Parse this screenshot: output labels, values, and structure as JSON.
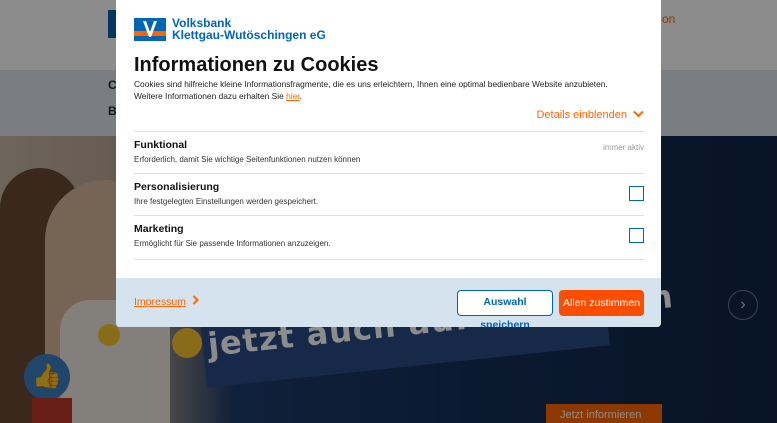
{
  "background": {
    "header_right_text": "on",
    "nav_items": [
      "C",
      "B"
    ],
    "banner_text": "jetzt auch auf Instagram",
    "cta_label": "Jetzt informieren",
    "next_arrow": "›"
  },
  "modal": {
    "logo": {
      "line1": "Volksbank",
      "line2": "Klettgau-Wutöschingen eG"
    },
    "title": "Informationen zu Cookies",
    "intro_text": "Cookies sind hilfreiche kleine Informationsfragmente, die es uns erleichtern, Ihnen eine optimal bedienbare Website anzubieten. Weitere Informationen dazu erhalten Sie ",
    "intro_link": "hier",
    "intro_end": ".",
    "details_label": "Details einblenden",
    "sections": [
      {
        "title": "Funktional",
        "description": "Erforderlich, damit Sie wichtige Seitenfunktionen nutzen können",
        "status": "immer aktiv"
      },
      {
        "title": "Personalisierung",
        "description": "Ihre festgelegten Einstellungen werden gespeichert.",
        "checked": false
      },
      {
        "title": "Marketing",
        "description": "Ermöglicht für Sie passende Informationen anzuzeigen.",
        "checked": false
      }
    ],
    "footer": {
      "impressum_label": "Impressum",
      "save_label": "Auswahl speichern",
      "accept_all_label": "Allen zustimmen"
    }
  },
  "colors": {
    "brand_blue": "#0066b3",
    "brand_orange": "#ff6600",
    "accept_button": "#ff4d00",
    "footer_bg": "#d5e3ef"
  }
}
